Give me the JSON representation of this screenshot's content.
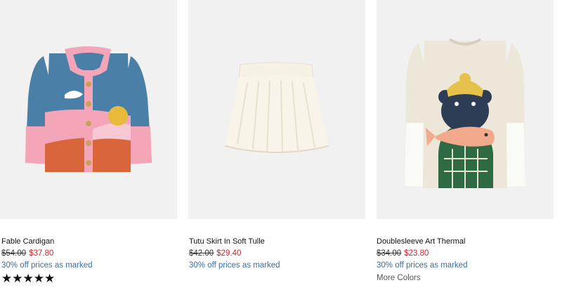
{
  "products": [
    {
      "name": "Fable Cardigan",
      "old_price": "$54.00",
      "new_price": "$37.80",
      "promo": "30% off prices as marked",
      "stars": "★★★★★",
      "rating": 5
    },
    {
      "name": "Tutu Skirt In Soft Tulle",
      "old_price": "$42.00",
      "new_price": "$29.40",
      "promo": "30% off prices as marked"
    },
    {
      "name": "Doublesleeve Art Thermal",
      "old_price": "$34.00",
      "new_price": "$23.80",
      "promo": "30% off prices as marked",
      "more": "More Colors"
    }
  ],
  "colors": {
    "sale_price": "#c1272d",
    "promo_text": "#3a6ea5",
    "image_bg": "#f1f1f1"
  }
}
